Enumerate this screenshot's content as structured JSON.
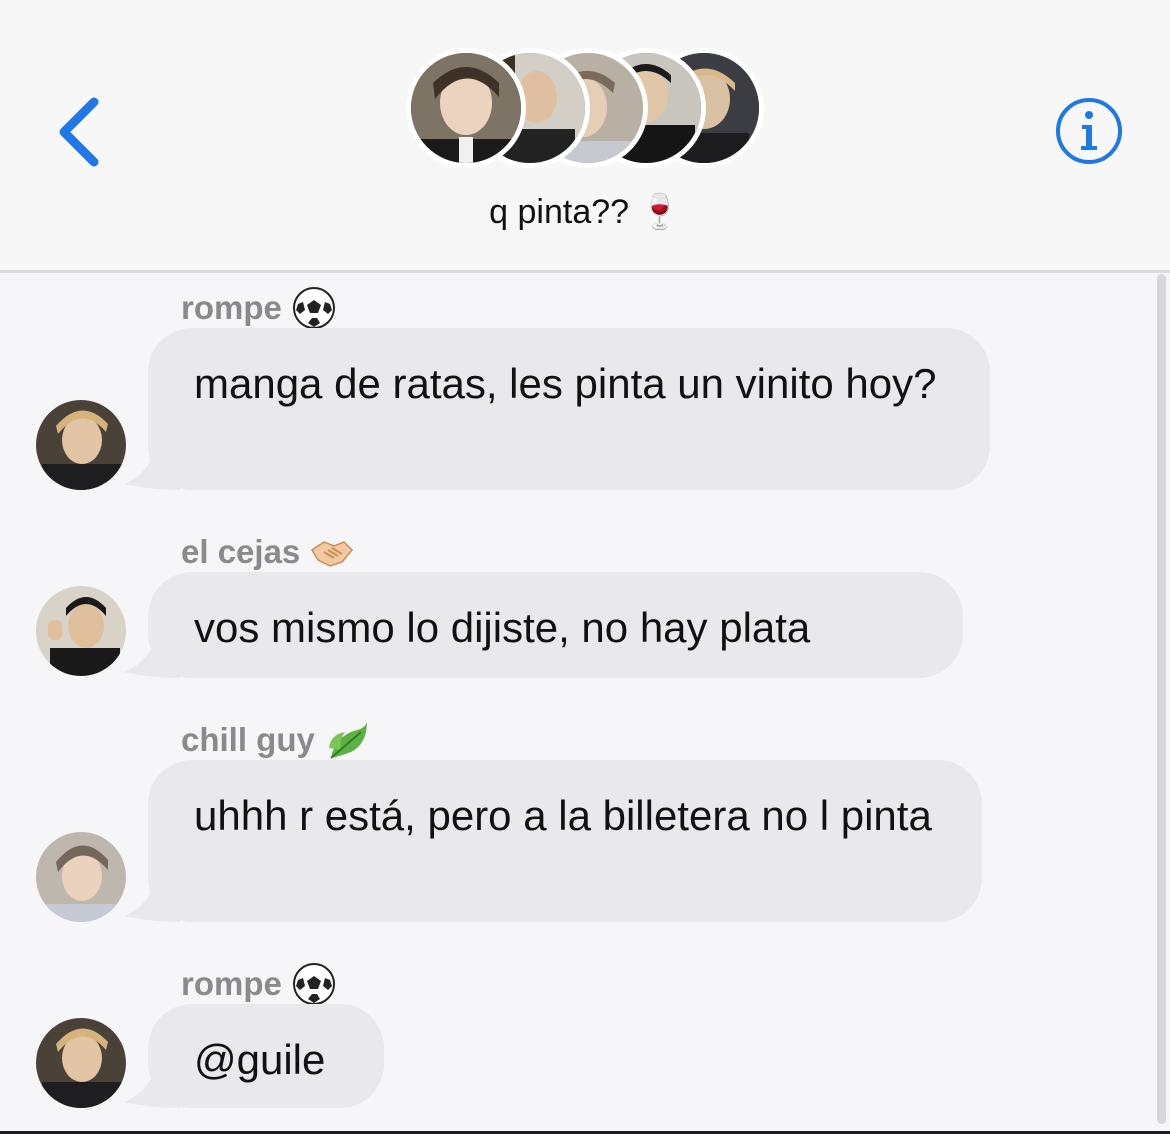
{
  "header": {
    "group_name": "q pinta?? 🍷",
    "back_icon": "chevron-left-icon",
    "info_icon": "info-icon",
    "accent_color": "#1f78e6"
  },
  "messages": [
    {
      "sender": "rompe",
      "sender_emoji": "soccer-ball-icon",
      "text": "manga de ratas, les pinta un vinito hoy?"
    },
    {
      "sender": "el cejas",
      "sender_emoji": "handshake-icon",
      "text": "vos mismo lo dijiste, no hay plata"
    },
    {
      "sender": "chill guy",
      "sender_emoji": "leaf-icon",
      "text": "uhhh r está, pero a la billetera no l pinta"
    },
    {
      "sender": "rompe",
      "sender_emoji": "soccer-ball-icon",
      "text": "@guile"
    }
  ],
  "colors": {
    "bubble": "#e9e9eb",
    "background": "#f6f6f8",
    "sender_label": "#8a8a8e"
  }
}
